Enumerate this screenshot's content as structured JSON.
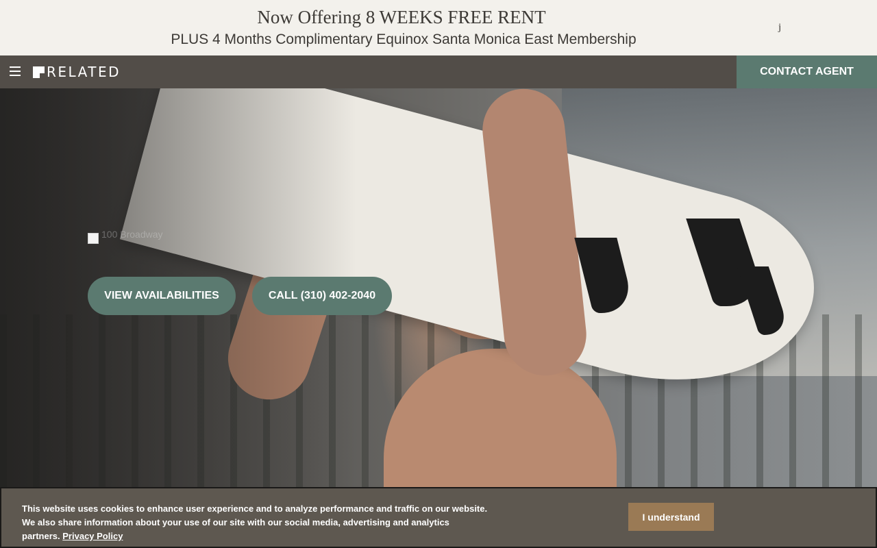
{
  "promo": {
    "line1": "Now Offering 8 WEEKS FREE RENT",
    "line2": "PLUS 4 Months Complimentary Equinox Santa Monica East Membership",
    "close_glyph": "j"
  },
  "nav": {
    "menu_icon": "hamburger-menu-icon",
    "logo_text": "RELATED",
    "contact_label": "CONTACT AGENT",
    "colors": {
      "bar": "#524d48",
      "accent": "#5b7a70"
    }
  },
  "hero": {
    "image_alt": "100 Broadway",
    "buttons": {
      "availabilities": "VIEW AVAILABILITIES",
      "call": "CALL (310) 402-2040"
    }
  },
  "cookie": {
    "text": "This website uses cookies to enhance user experience and to analyze performance and traffic on our website. We also share information about your use of our site with our social media, advertising and analytics partners.",
    "policy_link": "Privacy Policy",
    "button": "I understand",
    "colors": {
      "banner": "#5e5850",
      "button": "#9a7a55"
    }
  }
}
